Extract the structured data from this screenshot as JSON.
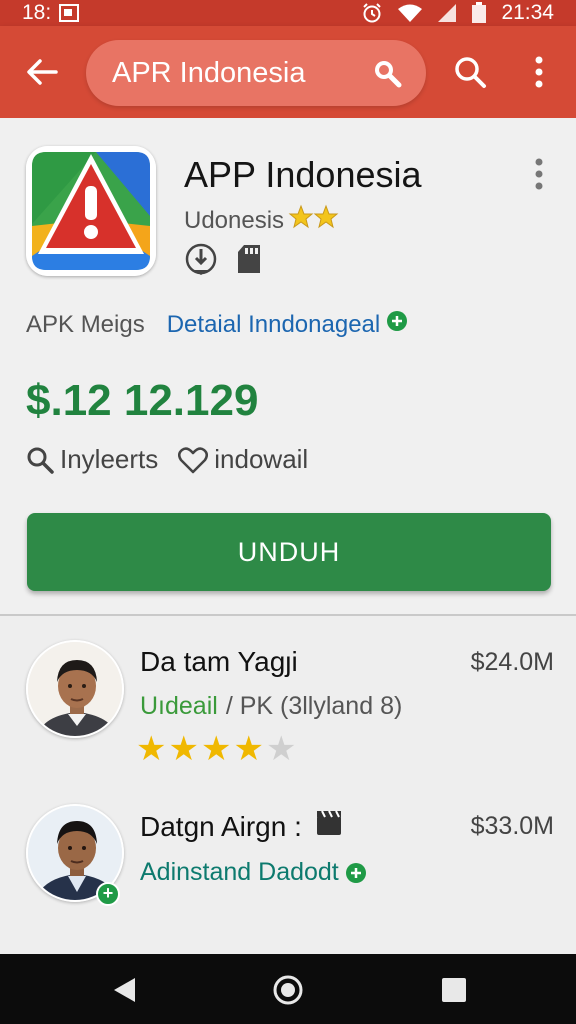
{
  "status_bar": {
    "time_left": "18:",
    "time_right": "21:34"
  },
  "app_bar": {
    "search_text": "APR Indonesia"
  },
  "app": {
    "title": "APP Indonesia",
    "developer": "Udonesis",
    "apk_label": "APK Meigs",
    "detail_link": "Detaial Inndonageal",
    "price": "$.12 12.129",
    "action_1": "Inyleerts",
    "action_2": "indowail",
    "download_label": "UNDUH"
  },
  "list": [
    {
      "name": "Da tam Yagȷi",
      "price": "$24.0M",
      "sub_highlight": "Uıdeail",
      "sub_rest": "/ PK (3llyland 8)",
      "rating": 4,
      "rating_max": 5
    },
    {
      "name": "Datgn Airgn :",
      "price": "$33.0M",
      "sub_highlight": "Adinstand Dadodt"
    }
  ],
  "colors": {
    "status_bar": "#c53a2b",
    "app_bar": "#d54a36",
    "accent_green": "#2e8a47",
    "price_green": "#21833f",
    "link_blue": "#1c66b0"
  }
}
